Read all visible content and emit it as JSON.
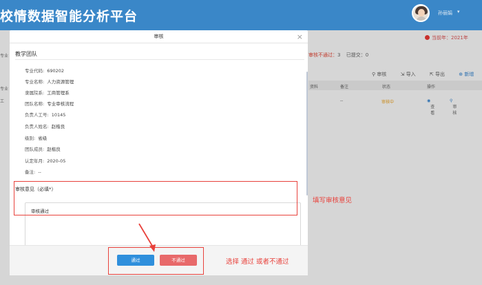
{
  "header": {
    "title": "校情数据智能分析平台",
    "user_name": "孙丽娟",
    "user_caret": "▾"
  },
  "background": {
    "notice": "当前年：2021年",
    "left_label_a": "专业",
    "left_label_b": "专业",
    "left_label_c": "工",
    "stats_fail_label": "审核不通过：",
    "stats_fail_value": "3",
    "stats_submitted": "已提交：0",
    "toolbar": {
      "audit": "审核",
      "import": "导入",
      "export": "导出",
      "add": "新增"
    },
    "table_headers": [
      "资料",
      "备注",
      "状态",
      "操作"
    ],
    "table_row": {
      "remark": "--",
      "status": "审核中",
      "op_view": "查看",
      "op_audit": "审核"
    }
  },
  "modal": {
    "title": "审核",
    "close_glyph": "×",
    "section_title": "教学团队",
    "fields": [
      {
        "label": "专业代码:",
        "value": "690202"
      },
      {
        "label": "专业名称:",
        "value": "人力资源管理"
      },
      {
        "label": "隶属院系:",
        "value": "工商管理系"
      },
      {
        "label": "团队名称:",
        "value": "专业审核流程"
      },
      {
        "label": "负责人工号:",
        "value": "10145"
      },
      {
        "label": "负责人姓名:",
        "value": "赵楷良"
      },
      {
        "label": "级别:",
        "value": "省级"
      },
      {
        "label": "团队成员:",
        "value": "赵楷良"
      },
      {
        "label": "认定年月:",
        "value": "2020-05"
      },
      {
        "label": "备注:",
        "value": "--"
      }
    ],
    "opinion_label": "审核意见（必填*）",
    "opinion_value": "审核通过",
    "pass_button": "通过",
    "fail_button": "不通过"
  },
  "annotations": {
    "fill_opinion": "填写审核意见",
    "choose_result": "选择 通过 或者不通过"
  },
  "colors": {
    "header_bg": "#3a87c8",
    "pass_button": "#2f8fdc",
    "fail_button": "#e8696a",
    "annotation_red": "#e8413b"
  }
}
